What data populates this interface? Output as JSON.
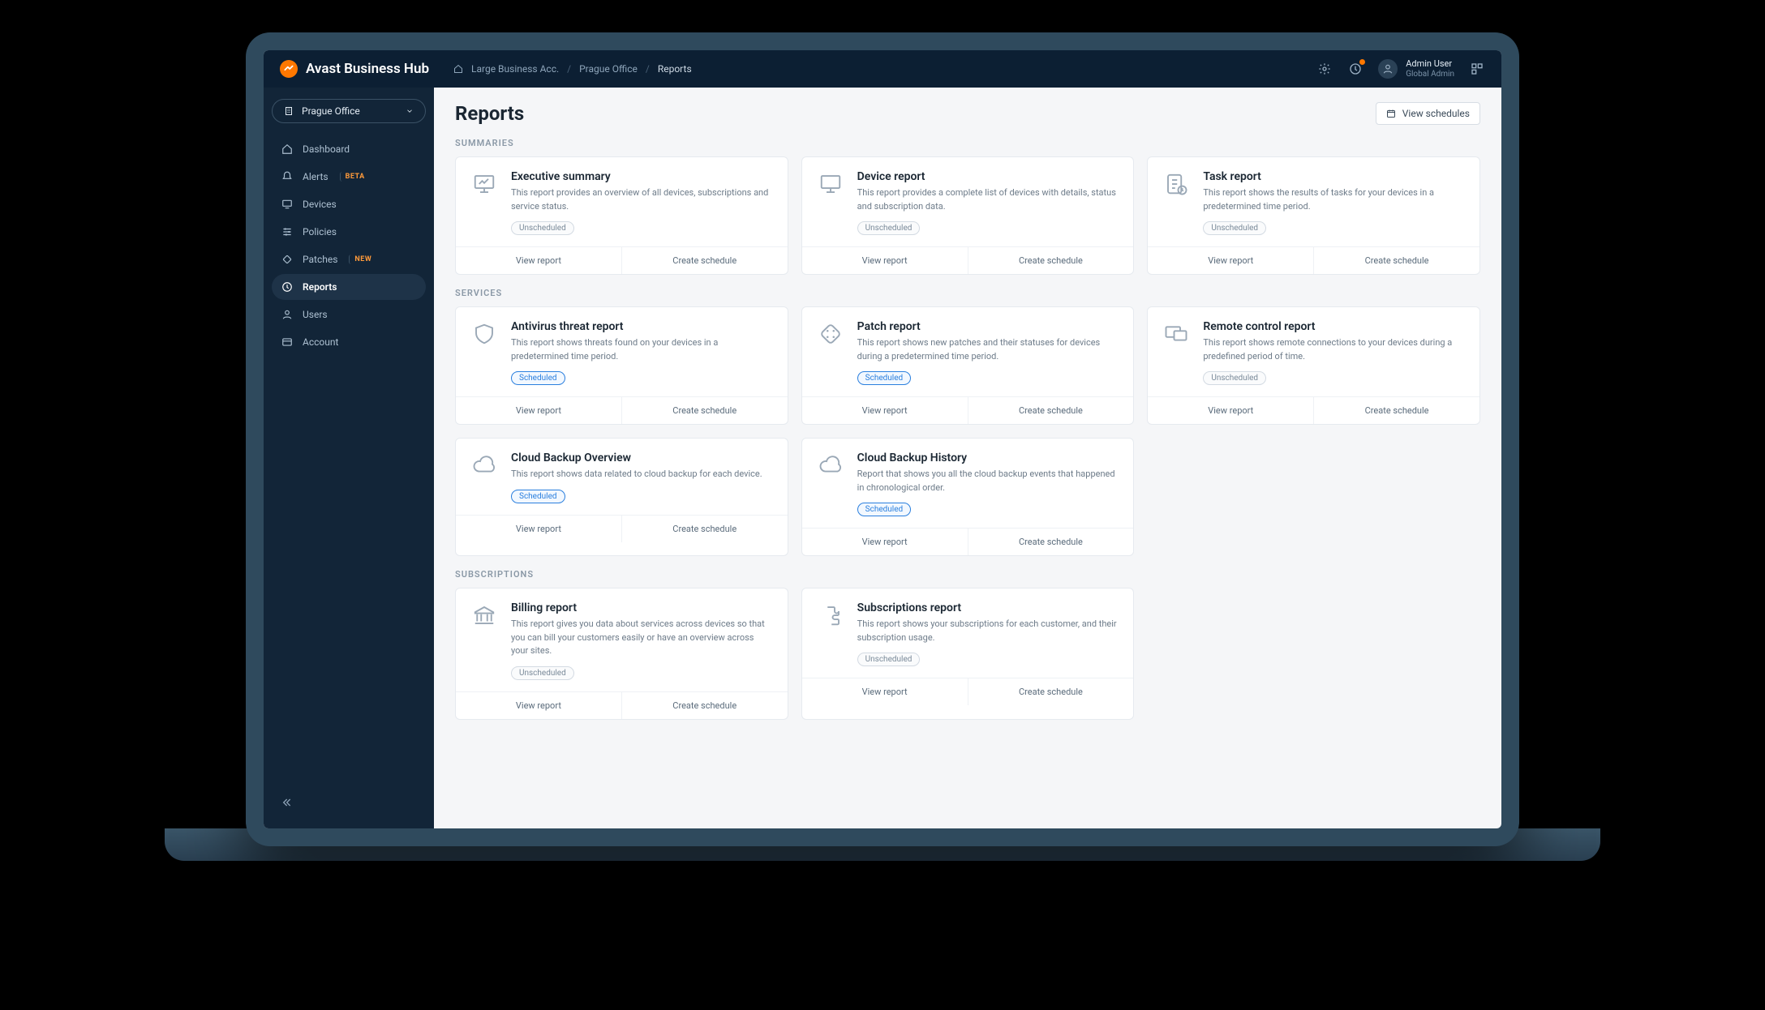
{
  "brand": "Avast Business Hub",
  "breadcrumbs": {
    "item1": "Large Business Acc.",
    "item2": "Prague Office",
    "item3": "Reports"
  },
  "user": {
    "name": "Admin User",
    "role": "Global Admin"
  },
  "orgSelect": "Prague Office",
  "sidebar": {
    "dashboard": "Dashboard",
    "alerts": "Alerts",
    "alerts_badge": "BETA",
    "devices": "Devices",
    "policies": "Policies",
    "patches": "Patches",
    "patches_badge": "NEW",
    "reports": "Reports",
    "users": "Users",
    "account": "Account"
  },
  "page": {
    "title": "Reports",
    "viewSchedules": "View schedules"
  },
  "sections": {
    "summaries": "SUMMARIES",
    "services": "SERVICES",
    "subscriptions": "SUBSCRIPTIONS"
  },
  "labels": {
    "viewReport": "View report",
    "createSchedule": "Create schedule",
    "unscheduled": "Unscheduled",
    "scheduled": "Scheduled"
  },
  "cards": {
    "exec": {
      "title": "Executive summary",
      "desc": "This report provides an overview of all devices, subscriptions and service status."
    },
    "device": {
      "title": "Device report",
      "desc": "This report provides a complete list of devices with details, status and subscription data."
    },
    "task": {
      "title": "Task report",
      "desc": "This report shows the results of tasks for your devices in a predetermined time period."
    },
    "antivirus": {
      "title": "Antivirus threat report",
      "desc": "This report shows threats found on your devices in a predetermined time period."
    },
    "patch": {
      "title": "Patch report",
      "desc": "This report shows new patches and their statuses for devices during a predetermined time period."
    },
    "remote": {
      "title": "Remote control report",
      "desc": "This report shows remote connections to your devices during a predefined period of time."
    },
    "backupOverview": {
      "title": "Cloud Backup Overview",
      "desc": "This report shows data related to cloud backup for each device."
    },
    "backupHistory": {
      "title": "Cloud Backup History",
      "desc": "Report that shows you all the cloud backup events that happened in chronological order."
    },
    "billing": {
      "title": "Billing report",
      "desc": "This report gives you data about services across devices so that you can bill your customers easily or have an overview across your sites."
    },
    "subscriptions": {
      "title": "Subscriptions report",
      "desc": "This report shows your subscriptions for each customer, and their subscription usage."
    }
  }
}
